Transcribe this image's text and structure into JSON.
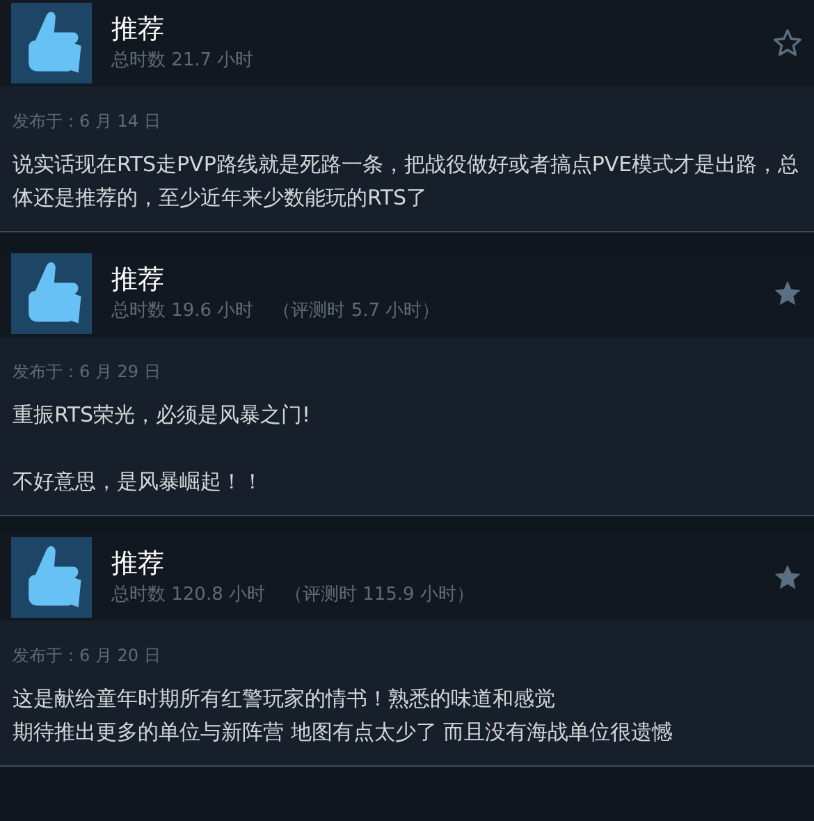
{
  "reviews": [
    {
      "verdict": "推荐",
      "hours": "总时数 21.7 小时",
      "starred": false,
      "date": "发布于：6 月 14 日",
      "paragraphs": [
        "说实话现在RTS走PVP路线就是死路一条，把战役做好或者搞点PVE模式才是出路，总体还是推荐的，至少近年来少数能玩的RTS了"
      ]
    },
    {
      "verdict": "推荐",
      "hours": "总时数 19.6 小时",
      "review_hours": "（评测时 5.7 小时）",
      "starred": true,
      "date": "发布于：6 月 29 日",
      "paragraphs_spaced": true,
      "paragraphs": [
        "重振RTS荣光，必须是风暴之门!",
        "不好意思，是风暴崛起！！"
      ]
    },
    {
      "verdict": "推荐",
      "hours": "总时数 120.8 小时",
      "review_hours": "（评测时 115.9 小时）",
      "starred": true,
      "date": "发布于：6 月 20 日",
      "paragraphs_spaced": false,
      "paragraphs": [
        "这是献给童年时期所有红警玩家的情书！熟悉的味道和感觉",
        "期待推出更多的单位与新阵营 地图有点太少了 而且没有海战单位很遗憾"
      ]
    }
  ]
}
